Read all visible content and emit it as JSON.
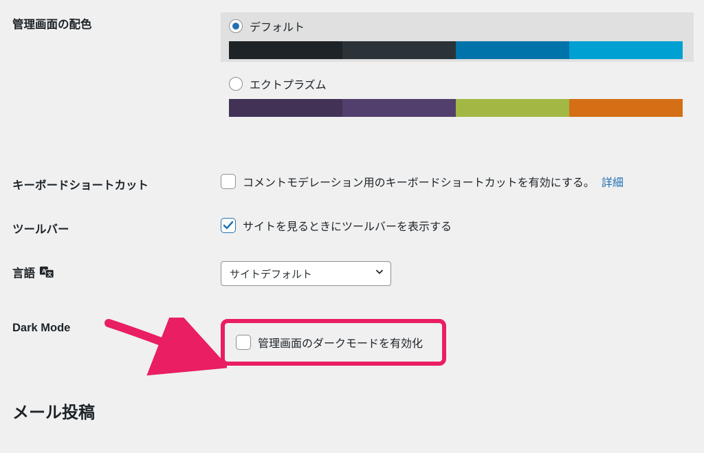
{
  "colorScheme": {
    "label": "管理画面の配色",
    "options": [
      {
        "name": "デフォルト",
        "selected": true,
        "colors": [
          "#1d2327",
          "#2c3338",
          "#0073aa",
          "#00a0d2"
        ]
      },
      {
        "name": "エクトプラズム",
        "selected": false,
        "colors": [
          "#413256",
          "#523f6d",
          "#a3b745",
          "#d46f15"
        ]
      }
    ]
  },
  "keyboardShortcuts": {
    "label": "キーボードショートカット",
    "checkboxLabel": "コメントモデレーション用のキーボードショートカットを有効にする。",
    "moreLink": "詳細",
    "checked": false
  },
  "toolbar": {
    "label": "ツールバー",
    "checkboxLabel": "サイトを見るときにツールバーを表示する",
    "checked": true
  },
  "language": {
    "label": "言語",
    "selected": "サイトデフォルト"
  },
  "darkMode": {
    "label": "Dark Mode",
    "checkboxLabel": "管理画面のダークモードを有効化",
    "checked": false
  },
  "sectionHeading": "メール投稿"
}
